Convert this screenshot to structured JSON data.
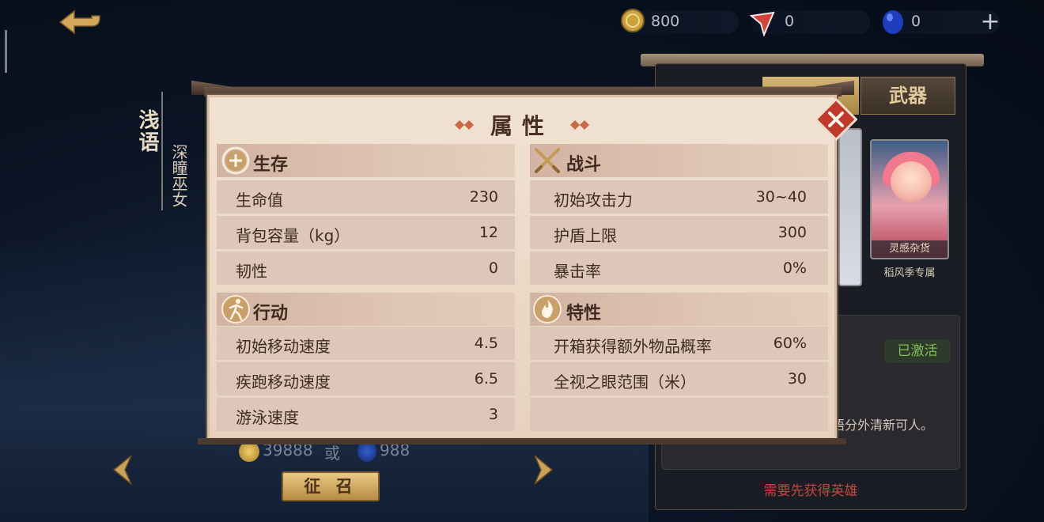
{
  "currency": {
    "coins": "800",
    "tickets": "0",
    "gems": "0",
    "add_label": "+"
  },
  "hero": {
    "name": "浅语",
    "title": "深瞳巫女"
  },
  "right_panel": {
    "weapon_tab": "武器",
    "card_label": "灵感杂货",
    "card_caption": "稻风季专属",
    "activated": "已激活",
    "description_fragment": "语分外清新可人。",
    "requirement": "需要先获得英雄"
  },
  "summon": {
    "price_coins": "39888",
    "price_or": "或",
    "price_gems": "988",
    "button": "征 召"
  },
  "modal": {
    "title": "属性",
    "sections": {
      "survival": {
        "title": "生存",
        "rows": [
          {
            "label": "生命值",
            "value": "230"
          },
          {
            "label": "背包容量（kg）",
            "value": "12"
          },
          {
            "label": "韧性",
            "value": "0"
          }
        ]
      },
      "combat": {
        "title": "战斗",
        "rows": [
          {
            "label": "初始攻击力",
            "value": "30~40"
          },
          {
            "label": "护盾上限",
            "value": "300"
          },
          {
            "label": "暴击率",
            "value": "0%"
          }
        ]
      },
      "movement": {
        "title": "行动",
        "rows": [
          {
            "label": "初始移动速度",
            "value": "4.5"
          },
          {
            "label": "疾跑移动速度",
            "value": "6.5"
          },
          {
            "label": "游泳速度",
            "value": "3"
          }
        ]
      },
      "traits": {
        "title": "特性",
        "rows": [
          {
            "label": "开箱获得额外物品概率",
            "value": "60%"
          },
          {
            "label": "全视之眼范围（米）",
            "value": "30"
          }
        ]
      }
    }
  },
  "colors": {
    "accent_gold": "#d6b777",
    "close_red": "#c0392b",
    "modal_bg": "#f0e2d2",
    "activated_green": "#7fbf5a",
    "requirement_red": "#c2473d"
  }
}
